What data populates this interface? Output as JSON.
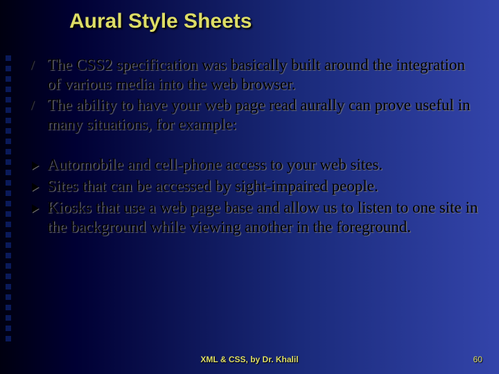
{
  "title": "Aural Style Sheets",
  "bullets_main": [
    "The CSS2 specification was basically built around the integration of various media into the web browser.",
    "The ability to have your web page read aurally can prove useful in many situations, for example:"
  ],
  "bullets_sub": [
    "Automobile and cell-phone access to your web sites.",
    "Sites that can be accessed by sight-impaired people.",
    "Kiosks that use a web page base and allow us to listen to one site in the background while viewing another in the foreground."
  ],
  "footer_center": "XML & CSS, by Dr. Khalil",
  "footer_right": "60"
}
